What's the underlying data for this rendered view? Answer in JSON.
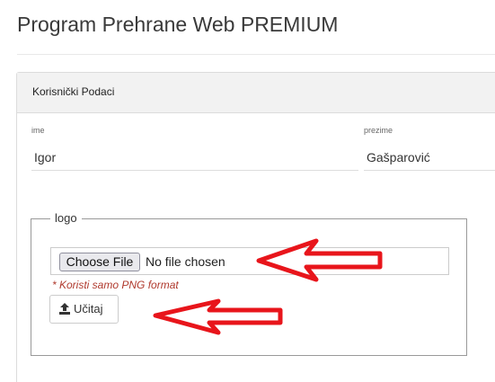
{
  "app": {
    "title": "Program Prehrane Web PREMIUM"
  },
  "panel": {
    "title": "Korisnički Podaci"
  },
  "fields": {
    "first_name": {
      "label": "ime",
      "value": "Igor"
    },
    "last_name": {
      "label": "prezime",
      "value": "Gašparović"
    }
  },
  "logo": {
    "legend": "logo",
    "choose_button": "Choose File",
    "file_status": "No file chosen",
    "hint": "* Koristi samo PNG format",
    "upload_button": "Učitaj"
  },
  "colors": {
    "annotation_arrow": "#e8151b",
    "hint_text": "#b03a2e"
  },
  "icons": {
    "upload": "upload-icon",
    "arrow": "red-arrow-annotation"
  }
}
